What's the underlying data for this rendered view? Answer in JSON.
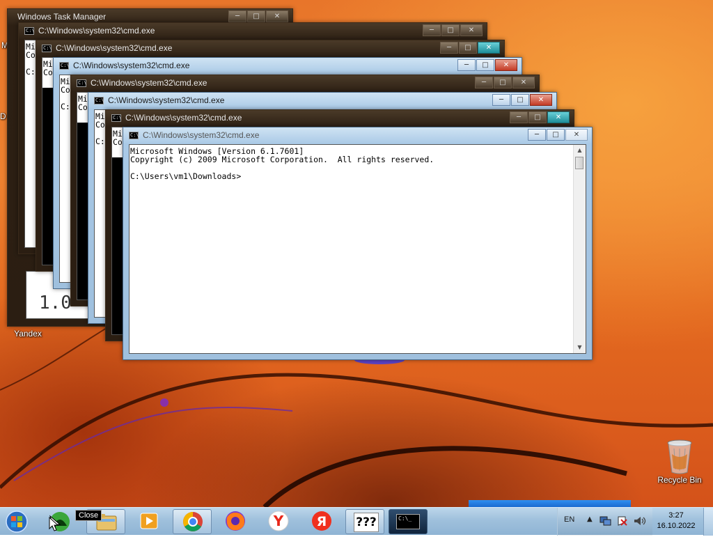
{
  "desktop": {
    "icons": [
      {
        "label": "Yandex"
      },
      {
        "label": "Recycle Bin"
      }
    ],
    "behind_window_fragments": [
      "M",
      "D",
      "1.0"
    ]
  },
  "windows": [
    {
      "title": "Windows Task Manager"
    },
    {
      "title": "C:\\Windows\\system32\\cmd.exe",
      "lines": [
        "Mi",
        "Co",
        "",
        "C:"
      ]
    },
    {
      "title": "C:\\Windows\\system32\\cmd.exe",
      "lines": [
        "Mi",
        "Co",
        "",
        "C:"
      ]
    },
    {
      "title": "C:\\Windows\\system32\\cmd.exe",
      "lines": [
        "Mi",
        "Co",
        "",
        "C:"
      ]
    },
    {
      "title": "C:\\Windows\\system32\\cmd.exe",
      "lines": [
        "Mi",
        "Co",
        "",
        "C:"
      ]
    },
    {
      "title": "C:\\Windows\\system32\\cmd.exe",
      "lines": [
        "Mi",
        "Co",
        "",
        "C:"
      ]
    },
    {
      "title": "C:\\Windows\\system32\\cmd.exe",
      "lines": [
        "Mi",
        "Co",
        "",
        "C:"
      ]
    },
    {
      "title": "C:\\Windows\\system32\\cmd.exe",
      "lines": [
        "Microsoft Windows [Version 6.1.7601]",
        "Copyright (c) 2009 Microsoft Corporation.  All rights reserved.",
        "",
        "C:\\Users\\vm1\\Downloads>"
      ]
    }
  ],
  "window_controls": {
    "minimize": "─",
    "maximize": "□",
    "close": "✕"
  },
  "scroll_glyphs": {
    "up": "▲",
    "down": "▼"
  },
  "taskbar": {
    "tooltip": "Close",
    "unknown_app_label": "???",
    "cmd_icon_label": "C:\\_",
    "yandex_letter": "Y",
    "yandex_browser_letter": "Я",
    "language": "EN",
    "clock_time": "3:27",
    "clock_date": "16.10.2022",
    "apps": [
      "start-orb",
      "green-app",
      "explorer",
      "media-player",
      "chrome",
      "firefox",
      "yandex",
      "yandex-browser",
      "unknown-app",
      "cmd"
    ]
  },
  "colors": {
    "wallpaper": "#ee8230",
    "inactive_frame": "#2d2014",
    "active_frame": "#a9c9e6",
    "close_button": "#c43a25",
    "taskbar": "#9fc0dc"
  }
}
